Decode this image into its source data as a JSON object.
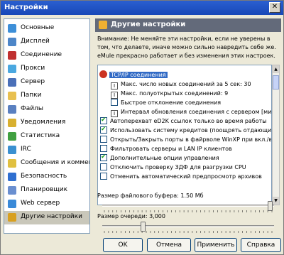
{
  "window": {
    "title": "Настройки",
    "close_glyph": "✕"
  },
  "sidebar": {
    "items": [
      {
        "label": "Основные",
        "icon": "gear-icon",
        "color": "#3d8fd8"
      },
      {
        "label": "Дисплей",
        "icon": "display-icon",
        "color": "#4d86c8"
      },
      {
        "label": "Соединение",
        "icon": "connection-icon",
        "color": "#c03030"
      },
      {
        "label": "Прокси",
        "icon": "proxy-icon",
        "color": "#4aa8e0"
      },
      {
        "label": "Сервер",
        "icon": "server-icon",
        "color": "#4a70b8"
      },
      {
        "label": "Папки",
        "icon": "folder-icon",
        "color": "#e8c050"
      },
      {
        "label": "Файлы",
        "icon": "files-icon",
        "color": "#5a80c0"
      },
      {
        "label": "Уведомления",
        "icon": "notifications-icon",
        "color": "#d8b030"
      },
      {
        "label": "Статистика",
        "icon": "statistics-icon",
        "color": "#40a040"
      },
      {
        "label": "IRC",
        "icon": "irc-icon",
        "color": "#3a90d0"
      },
      {
        "label": "Сообщения и комментарии",
        "icon": "messages-icon",
        "color": "#e0c040"
      },
      {
        "label": "Безопасность",
        "icon": "security-icon",
        "color": "#2f6fd0"
      },
      {
        "label": "Планировщик",
        "icon": "scheduler-icon",
        "color": "#6a8fd0"
      },
      {
        "label": "Web сервер",
        "icon": "web-server-icon",
        "color": "#3a8ad8"
      },
      {
        "label": "Другие настройки",
        "icon": "other-settings-icon",
        "color": "#d8a020"
      }
    ],
    "selected_index": 14
  },
  "panel": {
    "title": "Другие настройки",
    "warning": "Внимание: Не меняйте эти настройки, если не уверены в том, что делаете, иначе можно сильно навредить себе же. eMule прекрасно работает и без изменения этих настроек."
  },
  "tree": {
    "root_label": "TCP/IP соединения",
    "children": [
      {
        "type": "number",
        "label": "Макс. число новых соединений за 5 сек: 30"
      },
      {
        "type": "number",
        "label": "Макс. полуоткрытых соединений: 9"
      },
      {
        "type": "checkbox",
        "checked": false,
        "label": "Быстрое отклонение соединения"
      },
      {
        "type": "number",
        "label": "Интервал обновления соединения с сервером [мин.]:"
      }
    ],
    "items": [
      {
        "checked": true,
        "label": "Автоперехват eD2K ссылок только во время работы"
      },
      {
        "checked": true,
        "label": "Использовать систему кредитов (поощрять отдающих)"
      },
      {
        "checked": false,
        "label": "Открыть/Закрыть порты в файрволе WinXP при вкл./вык"
      },
      {
        "checked": false,
        "label": "Фильтровать серверы и LAN IP клиентов"
      },
      {
        "checked": true,
        "label": "Дополнительные опции управления"
      },
      {
        "checked": false,
        "label": "Отключить проверку ЗДФ для разгрузки CPU"
      },
      {
        "checked": false,
        "label": "Отменить автоматический предпросмотр архивов"
      }
    ]
  },
  "sliders": {
    "file_buffer_label": "Размер файлового буфера: 1.50 Мб",
    "file_buffer_level": 0.99,
    "queue_label": "Размер очереди: 3,000",
    "queue_level": 0.23
  },
  "buttons": {
    "ok": "OK",
    "cancel": "Отмена",
    "apply": "Применить",
    "help": "Справка"
  }
}
